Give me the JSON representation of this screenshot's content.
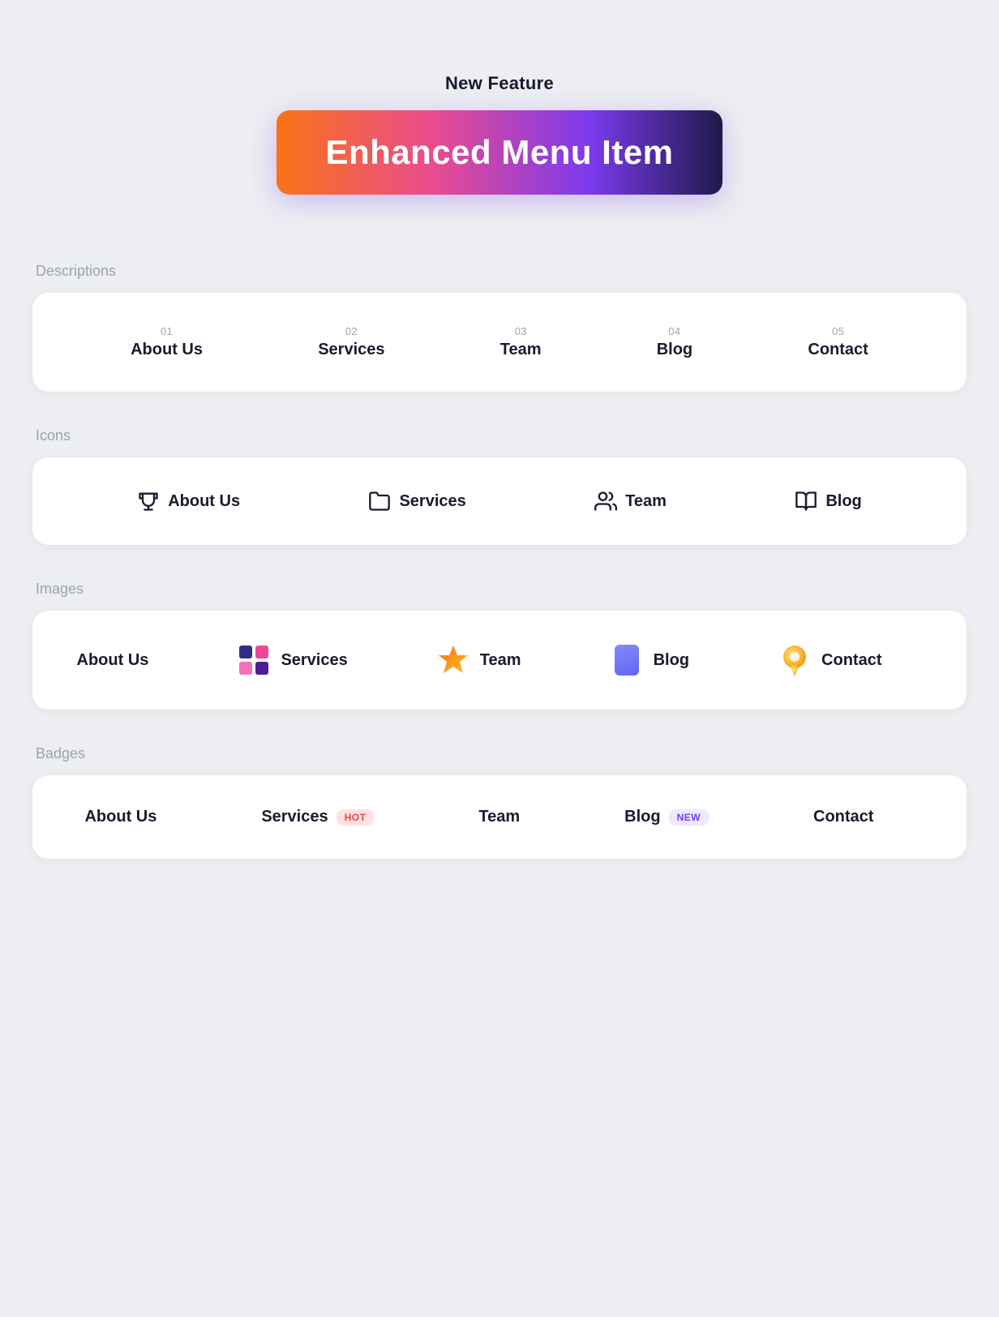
{
  "hero": {
    "new_feature_label": "New Feature",
    "banner_text": "Enhanced Menu Item"
  },
  "descriptions": {
    "section_label": "Descriptions",
    "items": [
      {
        "number": "01",
        "label": "About Us"
      },
      {
        "number": "02",
        "label": "Services"
      },
      {
        "number": "03",
        "label": "Team"
      },
      {
        "number": "04",
        "label": "Blog"
      },
      {
        "number": "05",
        "label": "Contact"
      }
    ]
  },
  "icons": {
    "section_label": "Icons",
    "items": [
      {
        "icon": "trophy",
        "label": "About Us"
      },
      {
        "icon": "folder",
        "label": "Services"
      },
      {
        "icon": "people",
        "label": "Team"
      },
      {
        "icon": "book",
        "label": "Blog"
      }
    ]
  },
  "images": {
    "section_label": "Images",
    "items": [
      {
        "icon": "none",
        "label": "About Us"
      },
      {
        "icon": "purple-grid",
        "label": "Services"
      },
      {
        "icon": "star-orange",
        "label": "Team"
      },
      {
        "icon": "blue-rect",
        "label": "Blog"
      },
      {
        "icon": "pin-yellow",
        "label": "Contact"
      }
    ]
  },
  "badges": {
    "section_label": "Badges",
    "items": [
      {
        "label": "About Us",
        "badge": null
      },
      {
        "label": "Services",
        "badge": "HOT",
        "badge_type": "hot"
      },
      {
        "label": "Team",
        "badge": null
      },
      {
        "label": "Blog",
        "badge": "NEW",
        "badge_type": "new"
      },
      {
        "label": "Contact",
        "badge": null
      }
    ]
  }
}
